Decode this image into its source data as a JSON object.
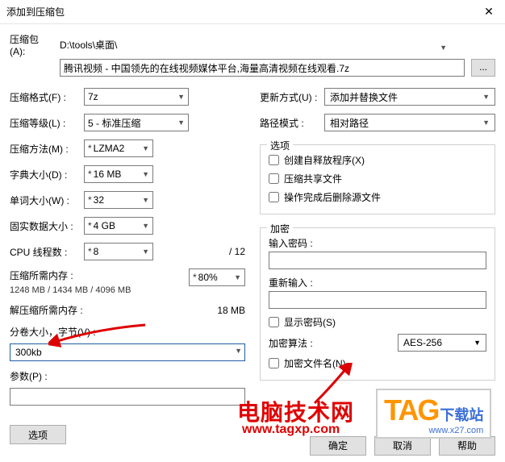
{
  "title": "添加到压缩包",
  "archive": {
    "label": "压缩包(A):",
    "path_prefix": "D:\\tools\\桌面\\",
    "filename": "腾讯视频 - 中国领先的在线视频媒体平台,海量高清视频在线观看.7z",
    "browse": "..."
  },
  "left": {
    "format": {
      "label": "压缩格式(F) :",
      "value": "7z"
    },
    "level": {
      "label": "压缩等级(L) :",
      "value": "5 - 标准压缩"
    },
    "method": {
      "label": "压缩方法(M) :",
      "value": "LZMA2",
      "star": "*"
    },
    "dict": {
      "label": "字典大小(D) :",
      "value": "16 MB",
      "star": "*"
    },
    "word": {
      "label": "单词大小(W) :",
      "value": "32",
      "star": "*"
    },
    "solid": {
      "label": "固实数据大小 :",
      "value": "4 GB",
      "star": "*"
    },
    "cpu": {
      "label": "CPU 线程数 :",
      "value": "8",
      "star": "*",
      "total": "/ 12"
    },
    "mem1_label": "压缩所需内存 :",
    "mem1_value": "1248 MB / 1434 MB / 4096 MB",
    "mem1_pct": "80%",
    "mem1_star": "*",
    "mem2_label": "解压缩所需内存 :",
    "mem2_value": "18 MB",
    "volume_label": "分卷大小，字节(V) :",
    "volume_value": "300kb",
    "param_label": "参数(P) :",
    "options_btn": "选项"
  },
  "right": {
    "update": {
      "label": "更新方式(U) :",
      "value": "添加并替换文件"
    },
    "pathmode": {
      "label": "路径模式 :",
      "value": "相对路径"
    },
    "options_group": "选项",
    "cb_sfx": "创建自释放程序(X)",
    "cb_share": "压缩共享文件",
    "cb_delete": "操作完成后删除源文件",
    "enc_group": "加密",
    "pw1": "输入密码 :",
    "pw2": "重新输入 :",
    "show_pw": "显示密码(S)",
    "alg_label": "加密算法 :",
    "alg_value": "AES-256",
    "enc_name": "加密文件名(N)"
  },
  "buttons": {
    "ok": "确定",
    "cancel": "取消",
    "help": "帮助"
  },
  "overlay": {
    "brand": "电脑技术网",
    "url": "www.tagxp.com",
    "tag": "TAG",
    "tag_suffix": "下载站",
    "tag_url": "www.x27.com"
  }
}
